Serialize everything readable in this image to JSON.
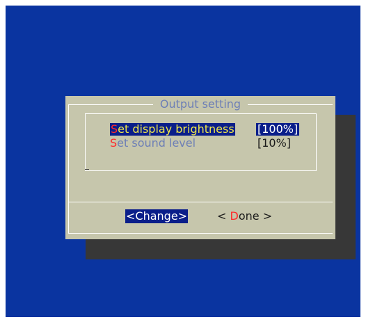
{
  "dialog": {
    "title": "Output setting",
    "menu_items": [
      {
        "hotkey": "S",
        "rest": "et display brightness",
        "value": "[100%]",
        "selected": true
      },
      {
        "hotkey": "S",
        "rest": "et sound level",
        "value": "[10%]",
        "selected": false
      }
    ],
    "buttons": {
      "change_label": "<Change>",
      "done_prefix": "< ",
      "done_hotkey": "D",
      "done_rest": "one >"
    }
  },
  "colors": {
    "background": "#0a34a0",
    "dialog": "#c6c6ac",
    "shadow": "#373737",
    "highlight": "#0a1e8a",
    "hotkey": "#ff2a2a",
    "title": "#6d7fb6"
  }
}
